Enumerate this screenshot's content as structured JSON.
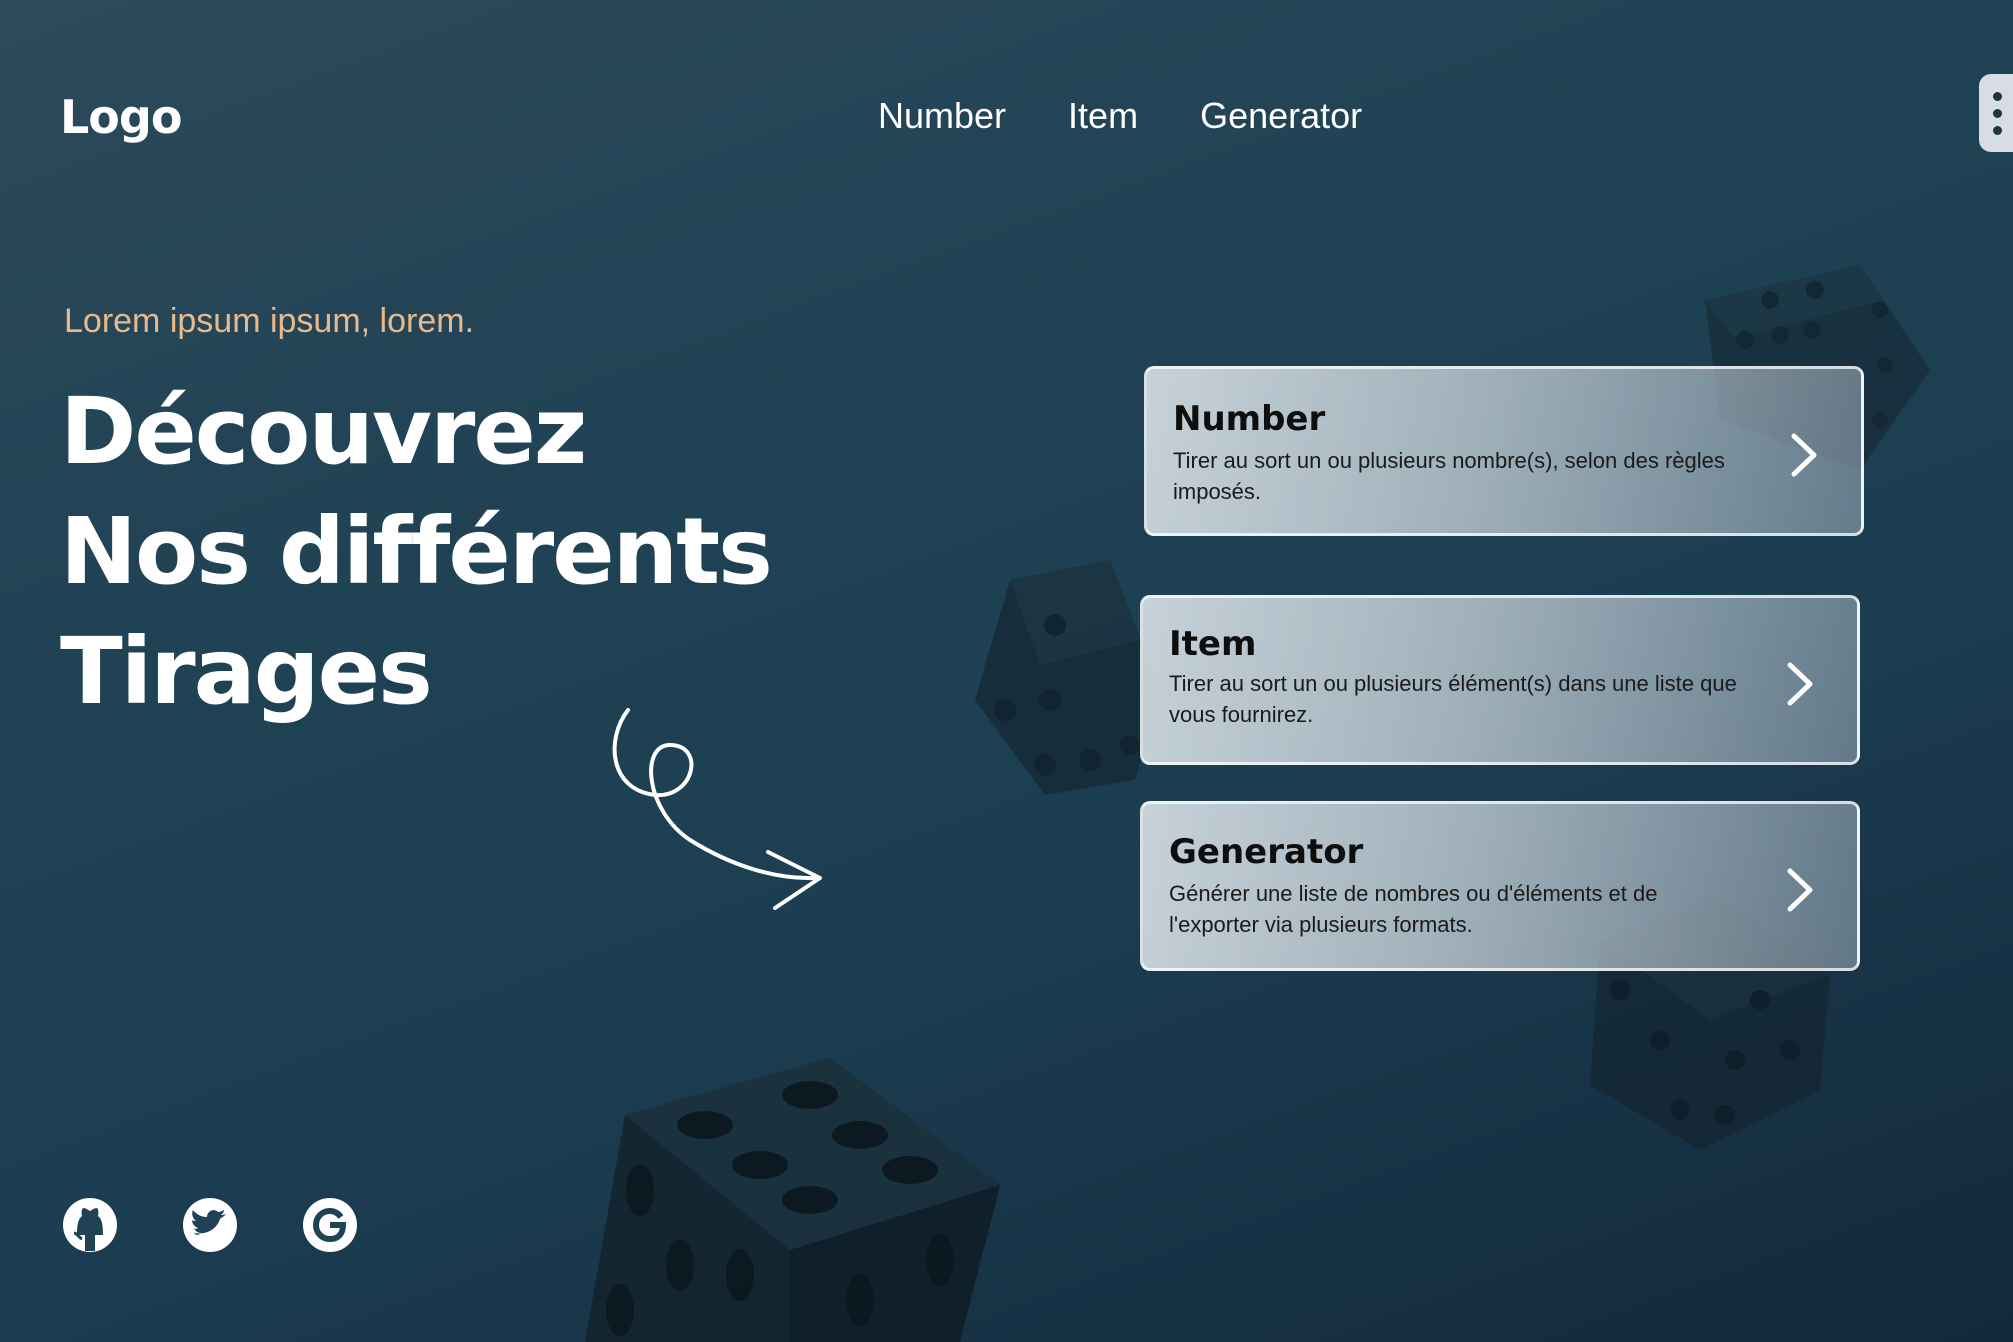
{
  "header": {
    "logo": "Logo",
    "nav": [
      "Number",
      "Item",
      "Generator"
    ]
  },
  "hero": {
    "tagline": "Lorem ipsum ipsum, lorem.",
    "title_lines": [
      "Découvrez",
      "Nos différents",
      "Tirages"
    ]
  },
  "cards": [
    {
      "title": "Number",
      "description": "Tirer au sort un ou plusieurs nombre(s), selon des règles imposés."
    },
    {
      "title": "Item",
      "description": "Tirer au sort un ou plusieurs élément(s) dans une liste que vous fournirez."
    },
    {
      "title": "Generator",
      "description": "Générer une liste de nombres ou d'éléments et de l'exporter via plusieurs formats."
    }
  ],
  "socials": [
    "github-icon",
    "twitter-icon",
    "google-icon"
  ],
  "colors": {
    "background": "#1f4254",
    "tagline": "#e8b98a",
    "card": "#c8d2d9",
    "dice": "#13232f"
  }
}
